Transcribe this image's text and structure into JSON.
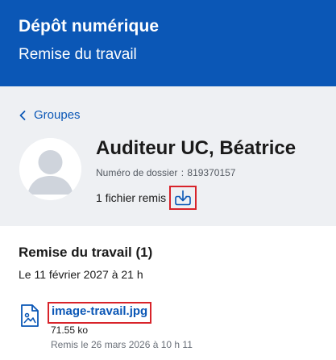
{
  "header": {
    "title": "Dépôt numérique",
    "subtitle": "Remise du travail",
    "background_color": "#0b57b6"
  },
  "profile": {
    "back_label": "Groupes",
    "back_icon": "chevron-left-icon",
    "avatar_icon": "user-silhouette-icon",
    "name": "Auditeur UC, Béatrice",
    "file_number_label": "Numéro de dossier",
    "file_number_value": "819370157",
    "submitted_count_text": "1 fichier remis",
    "download_icon": "download-icon"
  },
  "submission": {
    "title": "Remise du travail (1)",
    "due_text": "Le 11 février 2027 à 21 h",
    "file": {
      "icon": "image-file-icon",
      "name": "image-travail.jpg",
      "size": "71.55 ko",
      "submitted_text": "Remis le 26 mars 2026 à 10 h 11"
    }
  },
  "colors": {
    "accent": "#0b57b6",
    "highlight_border": "#d8232a",
    "profile_background": "#eef0f3"
  }
}
